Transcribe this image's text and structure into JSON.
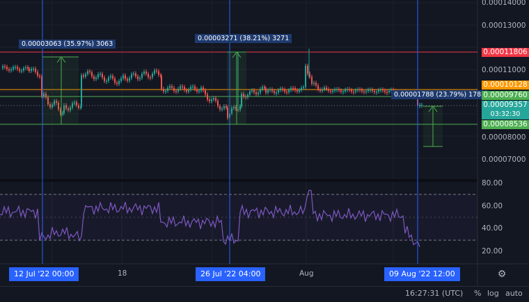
{
  "colors": {
    "background": "#131722",
    "grid": "#1e222d",
    "candle_up": "#26a69a",
    "candle_down": "#ef5350",
    "rsi_line": "#7e57c2",
    "rsi_band": "#7e57c2",
    "vertical_marker": "#2962ff",
    "measure_green": "#4caf50",
    "resistance_red": "#f23645",
    "level_orange": "#ff9800",
    "level_green": "#4caf50"
  },
  "price_axis": {
    "ticks": [
      "0.00014000",
      "0.00013000",
      "0.00011000",
      "0.00008000",
      "0.00007000"
    ]
  },
  "rsi_axis": {
    "ticks": [
      "80.00",
      "60.00",
      "40.00",
      "20.00"
    ]
  },
  "price_tags": {
    "resistance": "0.00011806",
    "orange_level": "0.00010128",
    "last_price": "0.00009760",
    "current": "0.00009357",
    "countdown": "03:32:30",
    "support": "0.00008536"
  },
  "measure_labels": {
    "m1": "0.00003063 (35.97%) 3063",
    "m2": "0.00003271 (38.21%) 3271",
    "m3": "0.00001788 (23.79%) 1788"
  },
  "time_axis": {
    "tag_left": "12 Jul '22   00:00",
    "label_18": "18",
    "tag_mid": "26 Jul '22   04:00",
    "label_aug": "Aug",
    "tag_right": "09 Aug '22   12:00"
  },
  "bottom_bar": {
    "clock": "16:27:31 (UTC)",
    "percent": "%",
    "log": "log",
    "auto": "auto"
  },
  "icons": {
    "settings": "gear-icon"
  }
}
